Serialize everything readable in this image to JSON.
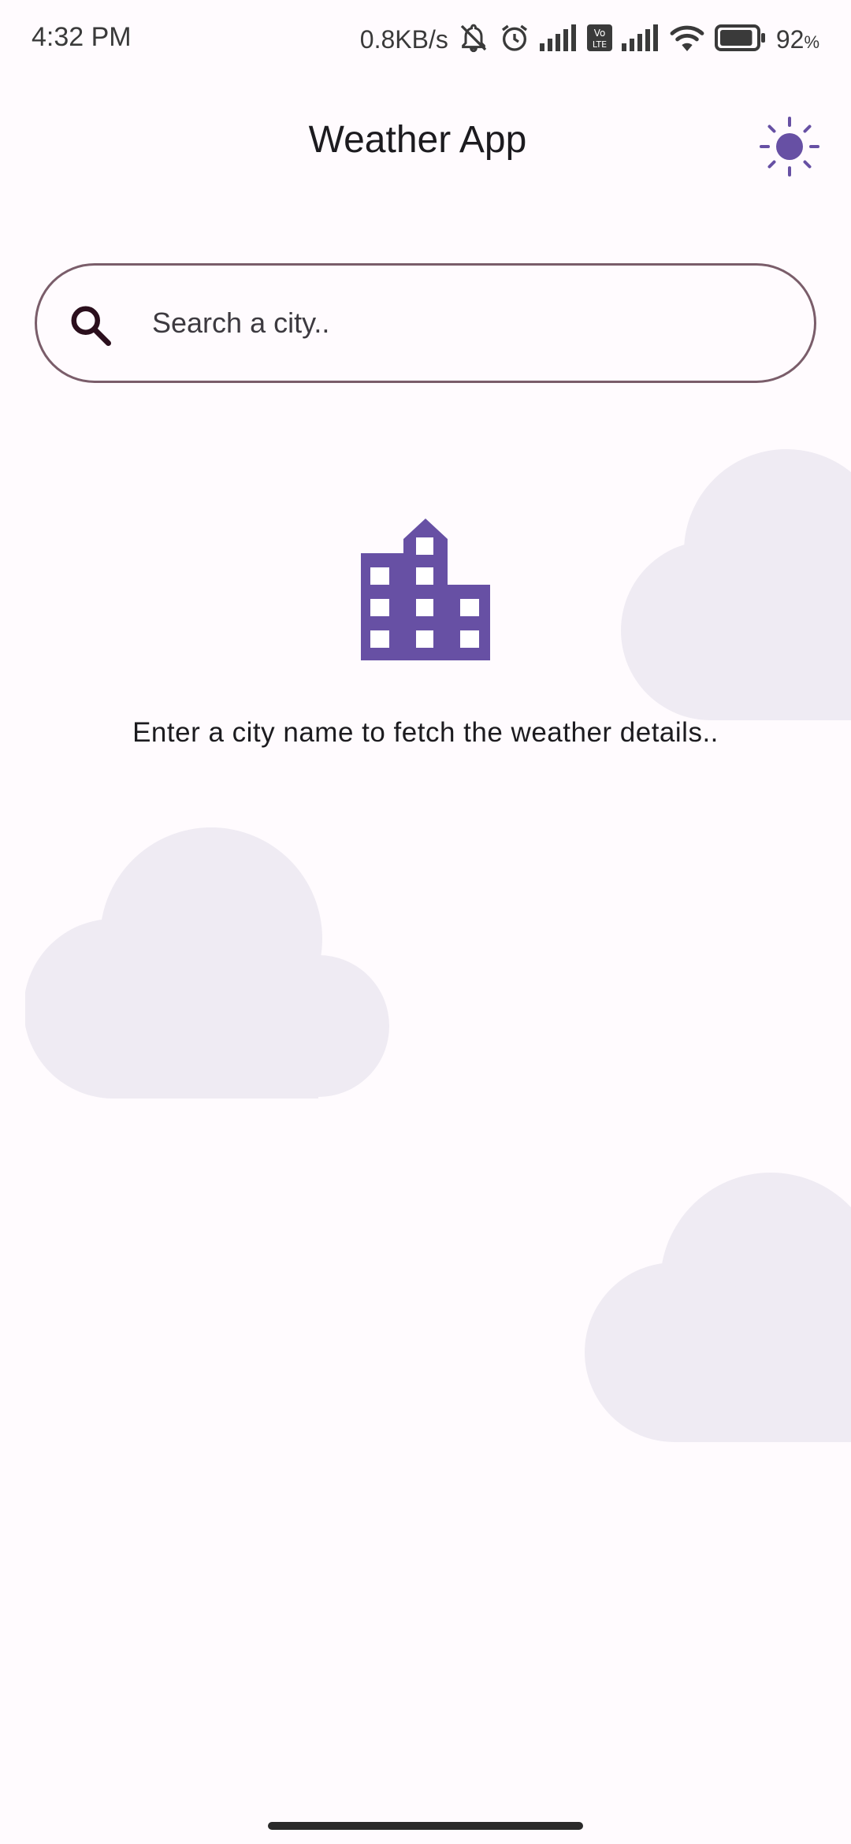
{
  "status_bar": {
    "time": "4:32 PM",
    "net_speed": "0.8KB/s",
    "volte_label": "Vo LTE",
    "battery_percent": "92",
    "battery_unit": "%",
    "battery_level": 0.92,
    "icons": [
      "bell-off-icon",
      "alarm-icon",
      "signal-icon",
      "volte-icon",
      "signal-icon",
      "wifi-icon",
      "battery-icon"
    ]
  },
  "header": {
    "title": "Weather App",
    "theme_icon": "sun-icon"
  },
  "search": {
    "placeholder": "Search a city..",
    "value": "",
    "icon": "search-icon"
  },
  "empty_state": {
    "icon": "city-building-icon",
    "message": "Enter a city name to fetch the weather details.."
  },
  "colors": {
    "background": "#FFFBFE",
    "accent": "#6750A4",
    "search_border": "#7a5d6a",
    "cloud": "#EFEBF3",
    "text": "#1C1B1F"
  }
}
